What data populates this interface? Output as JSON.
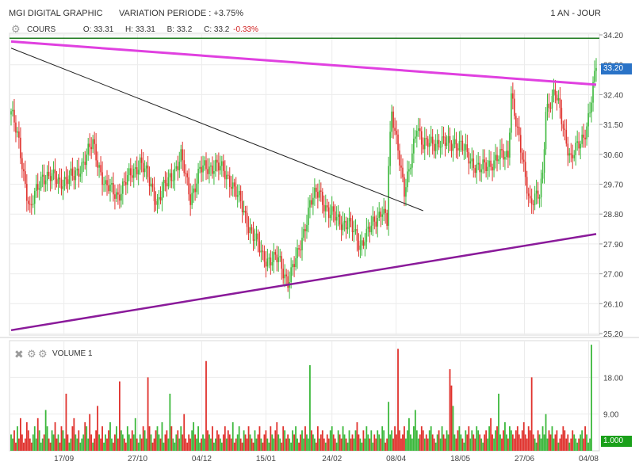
{
  "header": {
    "title": "MGI DIGITAL GRAPHIC",
    "variation": "VARIATION PERIODE : +3.75%",
    "period": "1 AN - JOUR"
  },
  "price_legend": {
    "label": "COURS",
    "open": "O: 33.31",
    "high": "H: 33.31",
    "low": "B: 33.2",
    "close": "C: 33.2",
    "change": "-0.33%"
  },
  "volume_legend": {
    "label": "VOLUME 1"
  },
  "badges": {
    "price": "33.20",
    "volume": "1.000"
  },
  "colors": {
    "up": "#3cb83c",
    "down": "#e0322d",
    "resistance": "#e040e0",
    "support": "#8a1a9a",
    "trend": "#222222",
    "level": "#1f7a1f",
    "badge_price": "#2a73c7",
    "badge_volume": "#1aa01a"
  },
  "icons": {
    "gear": "gear-icon",
    "close": "close-icon"
  },
  "chart_data": {
    "type": "candlestick",
    "x_tick_labels": [
      "17/09",
      "27/10",
      "04/12",
      "15/01",
      "24/02",
      "08/04",
      "18/05",
      "27/06",
      "04/08"
    ],
    "price_axis": {
      "ticks": [
        "34.20",
        "33.30",
        "32.40",
        "31.50",
        "30.60",
        "29.70",
        "28.80",
        "27.90",
        "27.00",
        "26.10",
        "25.20"
      ],
      "ylim": [
        25.2,
        34.2
      ]
    },
    "volume_axis": {
      "ticks": [
        "18.00",
        "9.00"
      ],
      "ylim": [
        0,
        27
      ]
    },
    "last_price": 33.2,
    "last_volume": 1.0,
    "close_anchors": [
      [
        0,
        31.9
      ],
      [
        5,
        30.9
      ],
      [
        12,
        28.9
      ],
      [
        20,
        30.0
      ],
      [
        30,
        29.8
      ],
      [
        40,
        29.9
      ],
      [
        52,
        30.9
      ],
      [
        60,
        29.6
      ],
      [
        68,
        29.4
      ],
      [
        82,
        30.4
      ],
      [
        93,
        29.2
      ],
      [
        100,
        29.8
      ],
      [
        108,
        30.5
      ],
      [
        114,
        29.3
      ],
      [
        120,
        30.1
      ],
      [
        130,
        30.3
      ],
      [
        140,
        29.8
      ],
      [
        150,
        28.6
      ],
      [
        160,
        27.5
      ],
      [
        170,
        27.4
      ],
      [
        176,
        26.8
      ],
      [
        182,
        27.5
      ],
      [
        190,
        29.1
      ],
      [
        196,
        29.5
      ],
      [
        202,
        28.8
      ],
      [
        210,
        28.6
      ],
      [
        216,
        28.4
      ],
      [
        222,
        27.9
      ],
      [
        228,
        28.3
      ],
      [
        236,
        29.0
      ],
      [
        239,
        28.5
      ],
      [
        240,
        30.2
      ],
      [
        242,
        31.8
      ],
      [
        246,
        30.9
      ],
      [
        250,
        29.4
      ],
      [
        253,
        30.0
      ],
      [
        258,
        31.6
      ],
      [
        262,
        30.8
      ],
      [
        268,
        31.0
      ],
      [
        276,
        30.9
      ],
      [
        282,
        31.0
      ],
      [
        290,
        30.6
      ],
      [
        298,
        30.1
      ],
      [
        306,
        30.4
      ],
      [
        316,
        30.6
      ],
      [
        318,
        32.5
      ],
      [
        322,
        31.2
      ],
      [
        330,
        29.2
      ],
      [
        336,
        29.3
      ],
      [
        338,
        30.0
      ],
      [
        340,
        32.0
      ],
      [
        346,
        32.4
      ],
      [
        350,
        31.7
      ],
      [
        356,
        30.4
      ],
      [
        364,
        31.2
      ],
      [
        366,
        31.5
      ],
      [
        368,
        31.9
      ],
      [
        372,
        33.2
      ]
    ],
    "volume_values": [
      4,
      3,
      5,
      2,
      6,
      3,
      8,
      4,
      2,
      3,
      7,
      5,
      3,
      2,
      4,
      6,
      3,
      8,
      5,
      2,
      3,
      4,
      10,
      6,
      3,
      2,
      5,
      4,
      7,
      3,
      4,
      2,
      6,
      5,
      3,
      14,
      4,
      2,
      3,
      6,
      8,
      4,
      3,
      5,
      2,
      3,
      4,
      7,
      6,
      3,
      9,
      4,
      2,
      3,
      5,
      11,
      4,
      3,
      6,
      2,
      4,
      3,
      5,
      7,
      3,
      2,
      4,
      6,
      3,
      17,
      5,
      4,
      3,
      2,
      6,
      4,
      3,
      5,
      4,
      8,
      3,
      2,
      4,
      3,
      6,
      5,
      3,
      18,
      6,
      4,
      2,
      3,
      5,
      6,
      4,
      3,
      7,
      2,
      4,
      5,
      3,
      14,
      6,
      3,
      2,
      4,
      5,
      3,
      6,
      4,
      9,
      3,
      2,
      4,
      3,
      5,
      7,
      4,
      3,
      6,
      2,
      3,
      4,
      3,
      22,
      5,
      4,
      3,
      6,
      2,
      3,
      5,
      4,
      3,
      2,
      4,
      6,
      3,
      5,
      4,
      3,
      7,
      2,
      3,
      4,
      6,
      3,
      2,
      5,
      4,
      3,
      6,
      4,
      3,
      2,
      5,
      3,
      4,
      6,
      3,
      2,
      4,
      5,
      3,
      2,
      6,
      4,
      3,
      5,
      7,
      4,
      3,
      2,
      6,
      5,
      3,
      4,
      3,
      2,
      5,
      4,
      6,
      3,
      2,
      4,
      5,
      3,
      6,
      4,
      3,
      21,
      5,
      4,
      3,
      2,
      6,
      3,
      4,
      5,
      3,
      2,
      4,
      3,
      5,
      6,
      4,
      3,
      2,
      5,
      4,
      3,
      6,
      4,
      3,
      2,
      5,
      3,
      4,
      3,
      5,
      7,
      4,
      3,
      2,
      5,
      3,
      6,
      4,
      3,
      5,
      2,
      4,
      3,
      5,
      4,
      3,
      6,
      5,
      2,
      3,
      12,
      4,
      5,
      3,
      6,
      4,
      25,
      5,
      3,
      4,
      6,
      3,
      5,
      8,
      4,
      3,
      6,
      10,
      5,
      3,
      4,
      6,
      5,
      3,
      4,
      3,
      5,
      6,
      4,
      3,
      2,
      4,
      5,
      3,
      6,
      4,
      3,
      5,
      4,
      20,
      16,
      11,
      4,
      3,
      5,
      6,
      4,
      3,
      2,
      5,
      4,
      6,
      3,
      5,
      4,
      3,
      6,
      5,
      4,
      3,
      2,
      4,
      5,
      3,
      6,
      8,
      4,
      3,
      5,
      6,
      14,
      4,
      3,
      5,
      7,
      4,
      3,
      6,
      5,
      4,
      3,
      5,
      6,
      4,
      3,
      5,
      7,
      4,
      3,
      6,
      5,
      18,
      4,
      3,
      2,
      5,
      4,
      3,
      6,
      4,
      9,
      3,
      5,
      4,
      6,
      3,
      4,
      5,
      2,
      3,
      4,
      6,
      5,
      3,
      4,
      2,
      3,
      5,
      4,
      3,
      2,
      3,
      4,
      5,
      3,
      6,
      4,
      2,
      3,
      26
    ],
    "overlays": {
      "resistance": {
        "from": [
          0,
          34.0
        ],
        "to": [
          372,
          32.7
        ],
        "color": "#e040e0"
      },
      "support": {
        "from": [
          0,
          25.3
        ],
        "to": [
          372,
          28.2
        ],
        "color": "#8a1a9a"
      },
      "trend": {
        "from": [
          0,
          33.8
        ],
        "to": [
          262,
          28.9
        ],
        "color": "#222222"
      },
      "level": {
        "value": 34.1,
        "color": "#1f7a1f"
      }
    }
  }
}
